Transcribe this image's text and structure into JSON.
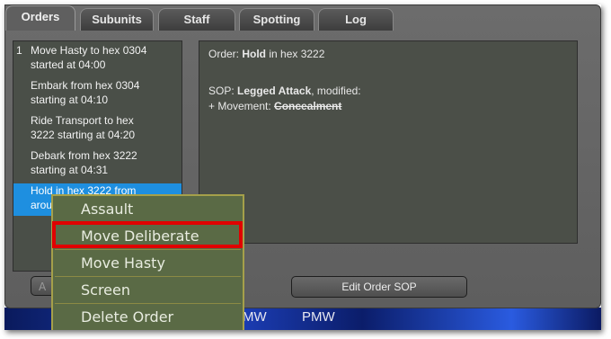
{
  "tabs": [
    {
      "label": "Orders"
    },
    {
      "label": "Subunits"
    },
    {
      "label": "Staff"
    },
    {
      "label": "Spotting"
    },
    {
      "label": "Log"
    }
  ],
  "orders": [
    {
      "num": "1",
      "line1": "Move Hasty to hex 0304",
      "line2": "started at 04:00"
    },
    {
      "num": "",
      "line1": "Embark from hex 0304",
      "line2": "starting at 04:10"
    },
    {
      "num": "",
      "line1": "Ride Transport to hex",
      "line2": "3222 starting at 04:20"
    },
    {
      "num": "",
      "line1": "Debark from hex 3222",
      "line2": "starting at 04:31"
    },
    {
      "num": "",
      "line1": "Hold in hex 3222 from",
      "line2": "arou"
    }
  ],
  "detail": {
    "order_label": "Order: ",
    "order_name": "Hold",
    "order_rest": " in hex 3222",
    "sop_label": "SOP: ",
    "sop_name": "Legged Attack",
    "sop_rest": ", modified:",
    "movement_label": "+ Movement: ",
    "movement_value": "Concealment"
  },
  "edit_sop_label": "Edit Order SOP",
  "left_button_label": "A",
  "context_menu": [
    {
      "label": "Assault"
    },
    {
      "label": "Move Deliberate"
    },
    {
      "label": "Move Hasty"
    },
    {
      "label": "Screen"
    },
    {
      "label": "Delete Order"
    }
  ],
  "taskbar": [
    "MW",
    "PMW"
  ],
  "colors": {
    "selected": "#1e8fe0",
    "highlight": "#e00000",
    "menu_bg": "#5a6a45"
  }
}
